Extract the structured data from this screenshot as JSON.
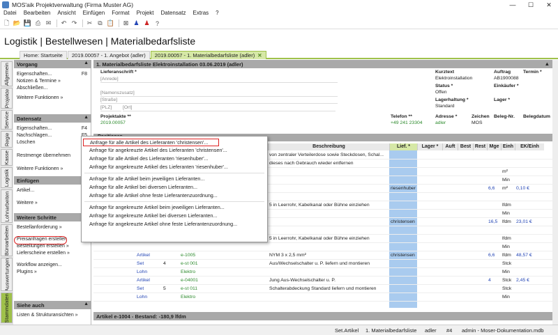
{
  "window": {
    "title": "MOS'aik Projektverwaltung (Firma Muster AG)",
    "min": "—",
    "max": "☐",
    "close": "✕"
  },
  "menubar": [
    "Datei",
    "Bearbeiten",
    "Ansicht",
    "Einfügen",
    "Format",
    "Projekt",
    "Datensatz",
    "Extras",
    "?"
  ],
  "header": {
    "title": "Logistik | Bestellwesen | Materialbedarfsliste"
  },
  "tabs": [
    {
      "label": "Home: Startseite"
    },
    {
      "label": "2019.00057 - 1. Angebot (adler)"
    },
    {
      "label": "2019.00057 - 1. Materialbedarfsliste (adler)",
      "close": "✕"
    }
  ],
  "vtabs": [
    "Allgemein",
    "Projekte",
    "Service",
    "Regie",
    "Kasse",
    "Logistik",
    "Lohnarbeiten",
    "Büroarbeiten",
    "Auswertungen",
    "Stammdaten"
  ],
  "side": {
    "vorgang": {
      "title": "Vorgang",
      "items": [
        {
          "label": "Eigenschaften...",
          "key": "F8"
        },
        {
          "label": "Notizen & Termine »"
        },
        {
          "label": "Abschließen..."
        },
        {
          "label": "Weitere Funktionen »"
        }
      ]
    },
    "datensatz": {
      "title": "Datensatz",
      "items": [
        {
          "label": "Eigenschaften...",
          "key": "F4"
        },
        {
          "label": "Nachschlagen...",
          "key": "F5"
        },
        {
          "label": "Löschen"
        },
        {
          "label": "Restmenge übernehmen"
        },
        {
          "label": "Weitere Funktionen »"
        }
      ]
    },
    "einfuegen": {
      "title": "Einfügen",
      "items": [
        {
          "label": "Artikel..."
        },
        {
          "label": "Weitere »"
        }
      ]
    },
    "weitere": {
      "title": "Weitere Schritte",
      "items": [
        {
          "label": "Bestellanforderung »"
        },
        {
          "label": "Preisanfragen erstellen"
        },
        {
          "label": "Bestellungen erstellen »"
        },
        {
          "label": "Lieferscheine erstellen »"
        },
        {
          "label": "Workflow anzeigen..."
        },
        {
          "label": "Plugins »"
        }
      ]
    },
    "sieheauch": {
      "title": "Siehe auch",
      "items": [
        {
          "label": "Listen & Strukturansichten »"
        }
      ]
    }
  },
  "main": {
    "title": "1. Materialbedarfsliste Elektroinstallation 03.06.2019 (adler)",
    "form": {
      "lieferanschrift_label": "Lieferanschrift *",
      "anrede": "[Anrede]",
      "namenszusatz": "[Namenszusatz]",
      "strasse": "[Straße]",
      "plz": "[PLZ]",
      "ort": "[Ort]",
      "kurztext_label": "Kurztext",
      "kurztext": "Elektroinstallation",
      "auftrag_label": "Auftrag",
      "auftrag": "AB1900088",
      "termin_label": "Termin *",
      "status_label": "Status *",
      "status": "Offen",
      "einkaeufer_label": "Einkäufer *",
      "lagerhaltung_label": "Lagerhaltung *",
      "lagerhaltung": "Standard",
      "lager_label": "Lager *",
      "projektakte_label": "Projektakte **",
      "projektakte": "2019.00057",
      "telefon_label": "Telefon **",
      "telefon": "+49 241 23304",
      "adresse_label": "Adresse *",
      "adresse": "adler",
      "zeichen_label": "Zeichen",
      "zeichen": "MOS",
      "belegnr_label": "Beleg-Nr.",
      "belegdatum_label": "Belegdatum"
    },
    "grid_header": "Positionen",
    "columns": [
      "Beschreibung",
      "Lief. *",
      "Lager *",
      "Auft",
      "Best",
      "Rest",
      "Mge",
      "Einh",
      "EK/Einh"
    ],
    "rows": [
      {
        "a": "",
        "b": "",
        "c": "",
        "desc": "von zentraler Verteilerdose sowie Steckdosen, Schal...",
        "lief": "",
        "mge": "",
        "einh": "",
        "ek": ""
      },
      {
        "a": "",
        "b": "",
        "c": "",
        "desc": "dieses nach Gebrauch wieder entfernen",
        "lief": "",
        "mge": "",
        "einh": "",
        "ek": ""
      },
      {
        "a": "",
        "b": "",
        "c": "",
        "desc": "",
        "lief": "",
        "mge": "",
        "einh": "m²",
        "ek": ""
      },
      {
        "a": "",
        "b": "",
        "c": "",
        "desc": "",
        "lief": "",
        "mge": "",
        "einh": "Min",
        "ek": ""
      },
      {
        "a": "",
        "b": "",
        "c": "",
        "desc": "",
        "lief": "riesenhuber",
        "mge": "6,6",
        "einh": "m²",
        "ek": "0,10 €"
      },
      {
        "a": "",
        "b": "",
        "c": "",
        "desc": "",
        "lief": "",
        "mge": "",
        "einh": "",
        "ek": ""
      },
      {
        "a": "",
        "b": "",
        "c": "",
        "desc": "5 in Leerrohr, Kabelkanal oder Bühne einziehen",
        "lief": "",
        "mge": "",
        "einh": "lfdm",
        "ek": ""
      },
      {
        "a": "",
        "b": "",
        "c": "",
        "desc": "",
        "lief": "",
        "mge": "",
        "einh": "Min",
        "ek": ""
      },
      {
        "a": "",
        "b": "",
        "c": "",
        "desc": "",
        "lief": "christensen",
        "mge": "16,5",
        "einh": "lfdm",
        "ek": "23,01 €"
      },
      {
        "a": "",
        "b": "",
        "c": "",
        "desc": "",
        "lief": "",
        "mge": "",
        "einh": "",
        "ek": ""
      },
      {
        "a": "",
        "b": "",
        "c": "",
        "desc": "5 in Leerrohr, Kabelkanal oder Bühne einziehen",
        "lief": "",
        "mge": "",
        "einh": "lfdm",
        "ek": ""
      },
      {
        "a": "",
        "b": "",
        "c": "",
        "desc": "",
        "lief": "",
        "mge": "",
        "einh": "Min",
        "ek": ""
      },
      {
        "a": "Artikel",
        "b": "",
        "c": "e-1005",
        "desc": "NYM 3 x 2,5 mm²",
        "lief": "christensen",
        "mge": "6,6",
        "einh": "lfdm",
        "ek": "48,57 €"
      },
      {
        "a": "Set",
        "b": "4",
        "c": "e-st 001",
        "desc": "Aus/Wechselschalter u. P. liefern und montieren",
        "lief": "",
        "mge": "",
        "einh": "Stck",
        "ek": ""
      },
      {
        "a": "Lohn",
        "b": "",
        "c": "Elektro",
        "desc": "",
        "lief": "",
        "mge": "",
        "einh": "Min",
        "ek": ""
      },
      {
        "a": "Artikel",
        "b": "",
        "c": "e-04001",
        "desc": "Jung Aus-Wechselschalter u. P.",
        "lief": "",
        "mge": "4",
        "einh": "Stck",
        "ek": "2,45 €"
      },
      {
        "a": "Set",
        "b": "5",
        "c": "e-st 011",
        "desc": "Schalterabdeckung Standard liefern und montieren",
        "lief": "",
        "mge": "",
        "einh": "Stck",
        "ek": ""
      },
      {
        "a": "Lohn",
        "b": "",
        "c": "Elektro",
        "desc": "",
        "lief": "",
        "mge": "",
        "einh": "Min",
        "ek": ""
      }
    ],
    "status_footer": "Artikel e-1004 - Bestand: -180,9 lfdm"
  },
  "context_menu": [
    "Anfrage für alle Artikel des Lieferanten 'christensen'...",
    "Anfrage für angekreuzte Artikel des Lieferanten 'christensen'...",
    "Anfrage für alle Artikel des Lieferanten 'riesenhuber'...",
    "Anfrage für angekreuzte Artikel des Lieferanten 'riesenhuber'...",
    "Anfrage für alle Artikel beim jeweiligen Lieferanten...",
    "Anfrage für alle Artikel bei diversen Lieferanten...",
    "Anfrage für alle Artikel ohne feste Lieferantenzuordnung...",
    "Anfrage für angekreuzte Artikel beim jeweiligen Lieferanten...",
    "Anfrage für angekreuzte Artikel bei diversen Lieferanten...",
    "Anfrage für angekreuzte Artikel ohne feste Lieferantenzuordnung..."
  ],
  "bottombar": {
    "mode": "Set.Artikel",
    "doc": "1. Materialbedarfsliste",
    "user": "adler",
    "num": "#4",
    "db": "admin - Moser-Dokumentation.mdb"
  },
  "colors": {
    "accent": "#9fc14a",
    "lief_col": "#a9cbef",
    "highlight": "#dd2222"
  }
}
